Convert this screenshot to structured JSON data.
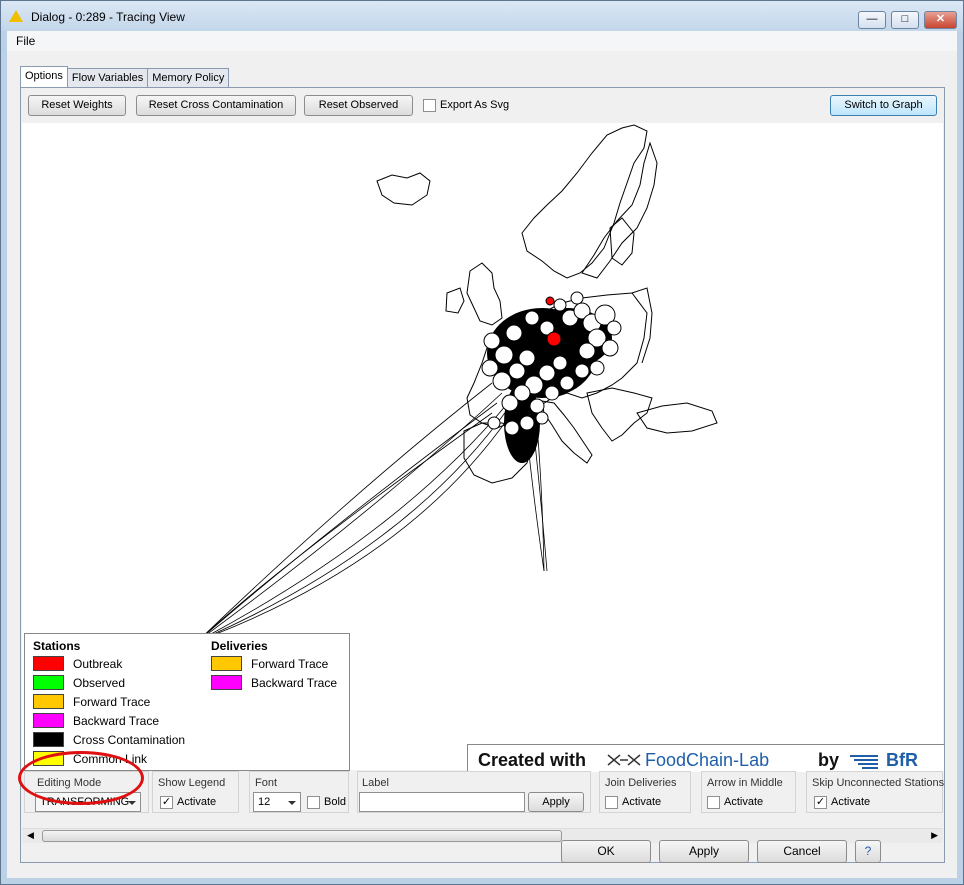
{
  "window": {
    "title": "Dialog - 0:289 - Tracing View",
    "minimize": "—",
    "maximize": "□",
    "close": "✕"
  },
  "menu": {
    "file": "File"
  },
  "tabs": [
    {
      "label": "Options"
    },
    {
      "label": "Flow Variables"
    },
    {
      "label": "Memory Policy"
    }
  ],
  "toolbar": {
    "reset_weights": "Reset Weights",
    "reset_cross": "Reset Cross Contamination",
    "reset_observed": "Reset Observed",
    "export_svg": "Export As Svg",
    "switch_graph": "Switch to Graph"
  },
  "legend": {
    "stations_title": "Stations",
    "deliveries_title": "Deliveries",
    "stations": [
      {
        "label": "Outbreak",
        "color": "#ff0000"
      },
      {
        "label": "Observed",
        "color": "#00ff00"
      },
      {
        "label": "Forward Trace",
        "color": "#ffc800"
      },
      {
        "label": "Backward Trace",
        "color": "#ff00ff"
      },
      {
        "label": "Cross Contamination",
        "color": "#000000"
      },
      {
        "label": "Common Link",
        "color": "#ffff00"
      }
    ],
    "deliveries": [
      {
        "label": "Forward Trace",
        "color": "#ffc800"
      },
      {
        "label": "Backward Trace",
        "color": "#ff00ff"
      }
    ]
  },
  "brand": {
    "created": "Created with",
    "product": "FoodChain-Lab",
    "by": "by",
    "org": "BfR"
  },
  "options": {
    "editing_mode_label": "Editing Mode",
    "editing_mode_value": "TRANSFORMING",
    "show_legend_label": "Show Legend",
    "show_legend_check": "Activate",
    "font_label": "Font",
    "font_size": "12",
    "bold_label": "Bold",
    "label_label": "Label",
    "label_apply": "Apply",
    "join_label": "Join Deliveries",
    "join_check": "Activate",
    "arrow_label": "Arrow in Middle",
    "arrow_check": "Activate",
    "skip_label": "Skip Unconnected Stations",
    "skip_check": "Activate"
  },
  "footer": {
    "ok": "OK",
    "apply": "Apply",
    "cancel": "Cancel",
    "help": "?"
  },
  "colors": {
    "outbreak": "#ff0000",
    "highlight_circle": "#e01010"
  }
}
